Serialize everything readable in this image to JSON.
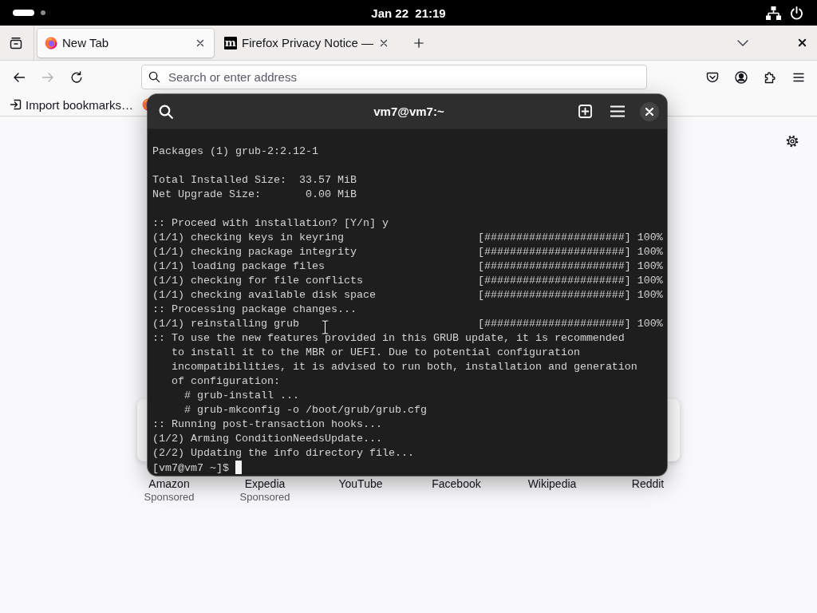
{
  "top_bar": {
    "workspaces": [
      {
        "selected": true
      },
      {
        "selected": false
      }
    ],
    "clock": "Jan 22  21:19"
  },
  "browser": {
    "tabs": [
      {
        "title": "New Tab",
        "selected": true
      },
      {
        "title": "Firefox Privacy Notice —",
        "favicon_text": "m",
        "selected": false
      }
    ],
    "navigation": [
      {
        "kind": "back",
        "disabled": false
      },
      {
        "kind": "forward",
        "disabled": true
      },
      {
        "kind": "reload",
        "disabled": false
      }
    ],
    "address_bar": {
      "placeholder": "Search or enter address"
    },
    "bookmarks": [
      {
        "kind": "import",
        "label": "Import bookmarks…"
      },
      {
        "kind": "site"
      }
    ]
  },
  "new_tab_page": {
    "shortcuts": [
      {
        "title": "Amazon",
        "label": "Sponsored"
      },
      {
        "title": "Expedia",
        "label": "Sponsored"
      },
      {
        "title": "YouTube"
      },
      {
        "title": "Facebook"
      },
      {
        "title": "Wikipedia"
      },
      {
        "title": "Reddit"
      }
    ]
  },
  "terminal": {
    "title": "vm7@vm7:~",
    "blocks": [
      [
        {
          "kind": "text",
          "text": "Packages (1) grub-2:2.12-1"
        }
      ],
      [
        {
          "kind": "field",
          "label": "Total Installed Size:",
          "value": "33.57 MiB"
        },
        {
          "kind": "field",
          "label": "Net Upgrade Size:",
          "value": "0.00 MiB"
        }
      ],
      [
        {
          "kind": "text",
          "text": ":: Proceed with installation? [Y/n] y"
        },
        {
          "kind": "progress",
          "label": "(1/1) checking keys in keyring",
          "bar": "[######################]",
          "percent": "100%"
        },
        {
          "kind": "progress",
          "label": "(1/1) checking package integrity",
          "bar": "[######################]",
          "percent": "100%"
        },
        {
          "kind": "progress",
          "label": "(1/1) loading package files",
          "bar": "[######################]",
          "percent": "100%"
        },
        {
          "kind": "progress",
          "label": "(1/1) checking for file conflicts",
          "bar": "[######################]",
          "percent": "100%"
        },
        {
          "kind": "progress",
          "label": "(1/1) checking available disk space",
          "bar": "[######################]",
          "percent": "100%"
        },
        {
          "kind": "text",
          "text": ":: Processing package changes..."
        },
        {
          "kind": "progress",
          "label": "(1/1) reinstalling grub",
          "bar": "[######################]",
          "percent": "100%"
        },
        {
          "kind": "text",
          "text": ":: To use the new features provided in this GRUB update, it is recommended"
        },
        {
          "kind": "text",
          "text": "   to install it to the MBR or UEFI. Due to potential configuration"
        },
        {
          "kind": "text",
          "text": "   incompatibilities, it is advised to run both, installation and generation"
        },
        {
          "kind": "text",
          "text": "   of configuration:"
        },
        {
          "kind": "text",
          "text": "     # grub-install ..."
        },
        {
          "kind": "text",
          "text": "     # grub-mkconfig -o /boot/grub/grub.cfg"
        },
        {
          "kind": "text",
          "text": ":: Running post-transaction hooks..."
        },
        {
          "kind": "text",
          "text": "(1/2) Arming ConditionNeedsUpdate..."
        },
        {
          "kind": "text",
          "text": "(2/2) Updating the info directory file..."
        }
      ]
    ],
    "prompt": "[vm7@vm7 ~]$"
  }
}
